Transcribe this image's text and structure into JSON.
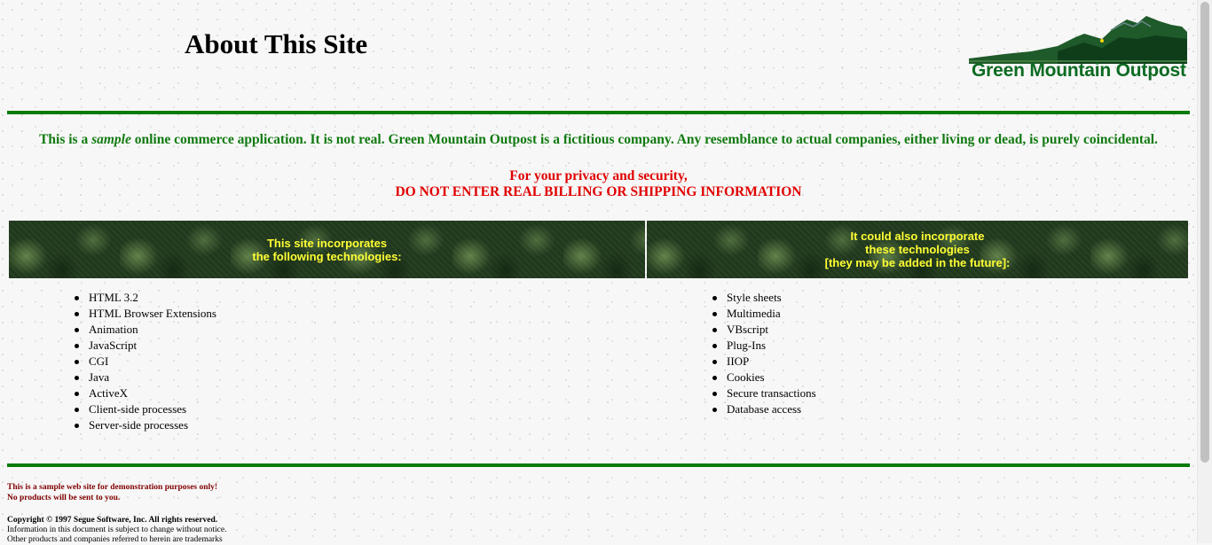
{
  "header": {
    "title": "About This Site",
    "logo_text": "Green Mountain Outpost"
  },
  "notice": {
    "prefix": "This is a ",
    "emphasis": "sample",
    "suffix": " online commerce application. It is not real. Green Mountain Outpost is a fictitious company. Any resemblance to actual companies, either living or dead, is purely coincidental.",
    "privacy_line1": "For your privacy and security,",
    "privacy_line2": "DO NOT ENTER REAL BILLING OR SHIPPING INFORMATION"
  },
  "tables": {
    "left_header": [
      "This site incorporates",
      "the following technologies:"
    ],
    "right_header": [
      "It could also incorporate",
      "these technologies",
      "[they may be added in the future]:"
    ],
    "left_items": [
      "HTML 3.2",
      "HTML Browser Extensions",
      "Animation",
      "JavaScript",
      "CGI",
      "Java",
      "ActiveX",
      "Client-side processes",
      "Server-side processes"
    ],
    "right_items": [
      "Style sheets",
      "Multimedia",
      "VBscript",
      "Plug-Ins",
      "IIOP",
      "Cookies",
      "Secure transactions",
      "Database access"
    ]
  },
  "footer": {
    "sample_line1": "This is a sample web site for demonstration purposes only!",
    "sample_line2": "No products will be sent to you.",
    "copyright": "Copyright © 1997 Segue Software, Inc. All rights reserved.",
    "info1": "Information in this document is subject to change without notice.",
    "info2": "Other products and companies referred to herein are trademarks"
  },
  "colors": {
    "accent_green": "#0a7a0a",
    "warning_red": "#e00000",
    "banner_text": "#ffff33",
    "footer_red": "#800000"
  }
}
